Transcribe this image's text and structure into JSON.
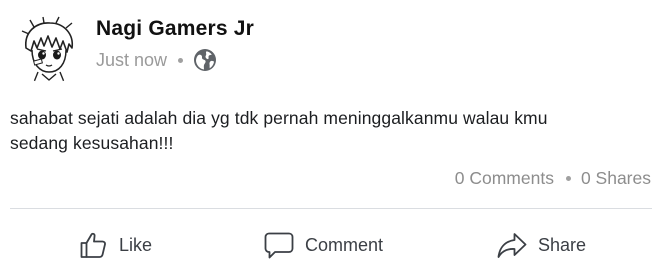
{
  "post": {
    "author": "Nagi Gamers Jr",
    "timestamp": "Just now",
    "privacy_icon": "globe-icon",
    "text": "sahabat sejati adalah dia yg tdk pernah meninggalkanmu walau kmu\nsedang kesusahan!!!",
    "comments_count": "0 Comments",
    "shares_count": "0 Shares"
  },
  "actions": {
    "like_label": "Like",
    "comment_label": "Comment",
    "share_label": "Share"
  },
  "colors": {
    "text": "#1c1e21",
    "meta": "#9a9a9a",
    "divider": "#dadde1",
    "action": "#3b3f45"
  }
}
